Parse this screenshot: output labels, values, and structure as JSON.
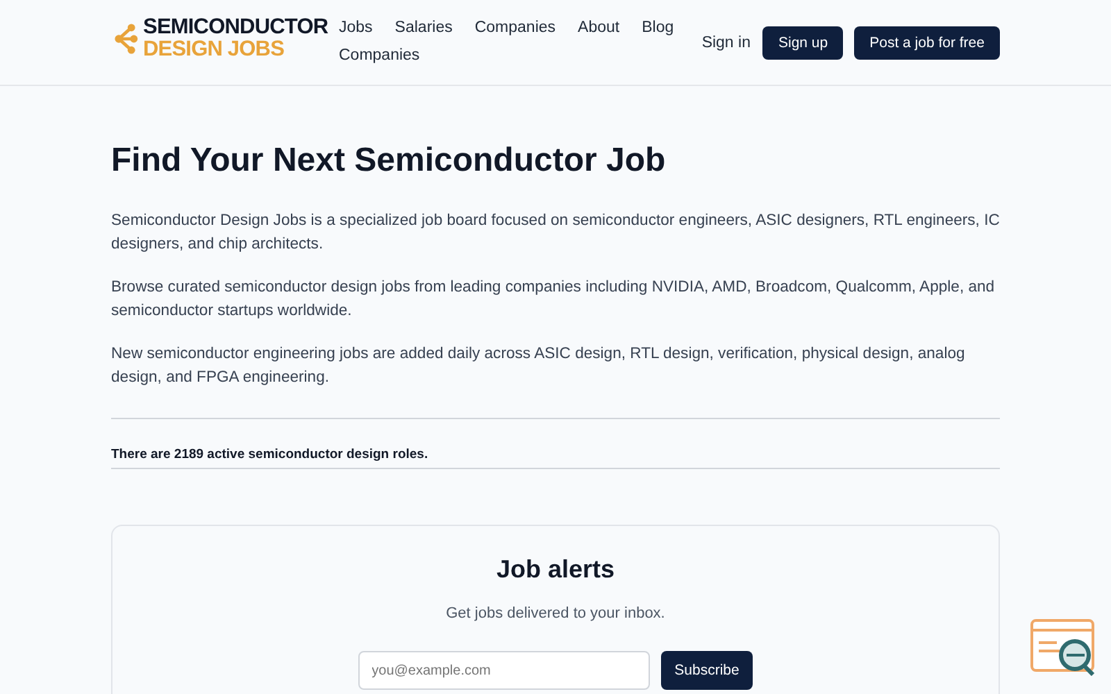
{
  "header": {
    "logo": {
      "line_1": "SEMICONDUCTOR",
      "line_2": "DESIGN JOBS"
    },
    "nav": [
      "Jobs",
      "Salaries",
      "Companies",
      "About",
      "Blog",
      "Companies"
    ],
    "sign_in": "Sign in",
    "sign_up": "Sign up",
    "post_job": "Post a job for free"
  },
  "main": {
    "title": "Find Your Next Semiconductor Job",
    "paragraphs": [
      "Semiconductor Design Jobs is a specialized job board focused on semiconductor engineers, ASIC designers, RTL engineers, IC designers, and chip architects.",
      "Browse curated semiconductor design jobs from leading companies including NVIDIA, AMD, Broadcom, Qualcomm, Apple, and semiconductor startups worldwide.",
      "New semiconductor engineering jobs are added daily across ASIC design, RTL design, verification, physical design, analog design, and FPGA engineering."
    ],
    "count_note": "There are 2189 active semiconductor design roles."
  },
  "alerts": {
    "title": "Job alerts",
    "subtitle": "Get jobs delivered to your inbox.",
    "email": {
      "placeholder": "you@example.com"
    },
    "button": "Subscribe"
  }
}
